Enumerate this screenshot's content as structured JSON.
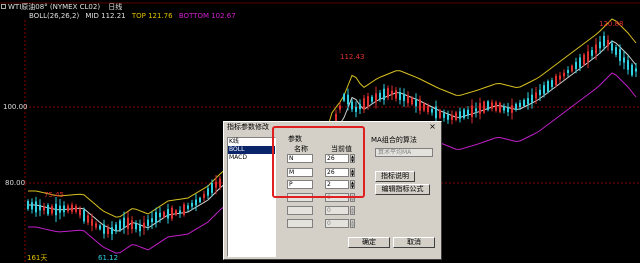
{
  "header": {
    "line1": "WTI原油08° (NYMEX CL02)",
    "period": "日线",
    "indicator": "BOLL(26,26,2)",
    "mid_label": "MID 112.21",
    "top_label": "TOP 121.76",
    "bottom_label": "BOTTOM 102.67"
  },
  "axis": {
    "y100": "100.00",
    "y80": "80.00"
  },
  "annotations": {
    "hi1": "112.43",
    "hi2": "120.88",
    "lo1": "61.12",
    "val_left": "75.45",
    "days": "161天"
  },
  "colors": {
    "up": "#e03030",
    "down": "#30d0e0",
    "mid": "#d0d0d0",
    "top": "#d8c020",
    "bottom": "#c020c8",
    "yellow": "#e0c000",
    "magenta": "#d020d0",
    "red_box": "#e02020"
  },
  "dialog": {
    "title": "指标参数修改",
    "close": "×",
    "list": [
      "K线",
      "BOLL",
      "MACD"
    ],
    "selected_index": 1,
    "params_title": "参数",
    "col_name": "名称",
    "col_value": "当前值",
    "rows": [
      {
        "name": "N",
        "value": "26",
        "enabled": true
      },
      {
        "name": "M",
        "value": "26",
        "enabled": true
      },
      {
        "name": "P",
        "value": "2",
        "enabled": true
      },
      {
        "name": "",
        "value": "0",
        "enabled": false
      },
      {
        "name": "",
        "value": "0",
        "enabled": false
      },
      {
        "name": "",
        "value": "0",
        "enabled": false
      }
    ],
    "ma_label": "MA组合的算法",
    "ma_select": "算术平均MA",
    "btn_help": "指标说明",
    "btn_edit": "编辑指标公式",
    "btn_ok": "确定",
    "btn_cancel": "取消"
  }
}
